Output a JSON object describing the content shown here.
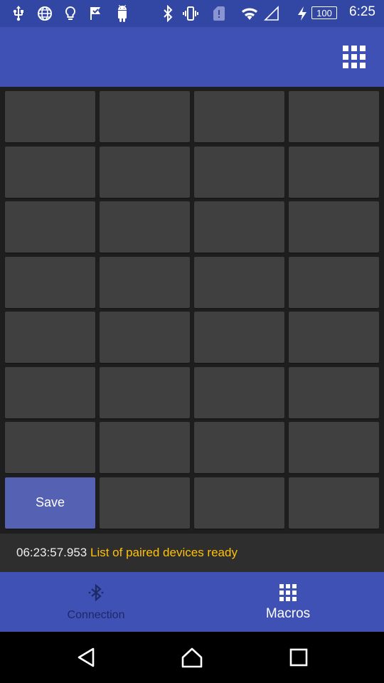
{
  "status_bar": {
    "icons": [
      "usb-icon",
      "globe-icon",
      "lightbulb-icon",
      "check-flag-icon",
      "android-icon",
      "bluetooth-icon",
      "vibrate-icon",
      "sim-alert-icon",
      "wifi-icon",
      "signal-icon",
      "charging-icon"
    ],
    "battery": "100",
    "time": "6:25"
  },
  "app_bar": {
    "action_icon": "grid-icon"
  },
  "macro_grid": {
    "columns": 4,
    "rows": 8,
    "save_label": "Save"
  },
  "log": {
    "timestamp": "06:23:57.953",
    "message": "List of paired devices ready"
  },
  "bottom_nav": {
    "tabs": [
      {
        "label": "Connection",
        "icon": "bluetooth-icon",
        "active": false
      },
      {
        "label": "Macros",
        "icon": "grid-icon",
        "active": true
      }
    ]
  },
  "colors": {
    "primary": "#3f51b5",
    "primary_dark": "#3247a3",
    "cell": "#404040",
    "save_cell": "#5561b3",
    "log_message": "#ffc107"
  }
}
